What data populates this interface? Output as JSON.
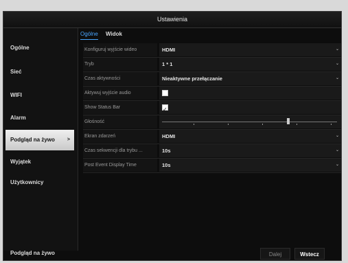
{
  "window": {
    "title": "Ustawienia"
  },
  "sidebar": {
    "items": [
      {
        "label": "Ogólne"
      },
      {
        "label": "Sieć"
      },
      {
        "label": "WIFI"
      },
      {
        "label": "Alarm"
      },
      {
        "label": "Podgląd na żywo",
        "active": true,
        "arrow": ">"
      },
      {
        "label": "Wyjątek"
      },
      {
        "label": "Użytkownicy"
      }
    ],
    "bottom_label": "Podgląd na żywo"
  },
  "tabs": [
    {
      "label": "Ogólne",
      "active": true
    },
    {
      "label": "Widok"
    }
  ],
  "settings": {
    "rows": [
      {
        "label": "Konfiguruj wyjście wideo",
        "value": "HDMI",
        "type": "dropdown"
      },
      {
        "label": "Tryb",
        "value": "1 * 1",
        "type": "dropdown"
      },
      {
        "label": "Czas aktywności",
        "value": "Nieaktywne przełączanie",
        "type": "dropdown"
      },
      {
        "label": "Aktywuj wyjście audio",
        "value": "",
        "type": "checkbox",
        "checked": false
      },
      {
        "label": "Show Status Bar",
        "value": "",
        "type": "checkbox",
        "checked": true
      },
      {
        "label": "Głośność",
        "value": "",
        "type": "slider",
        "level_fraction": 0.72
      },
      {
        "label": "Ekran zdarzeń",
        "value": "HDMI",
        "type": "dropdown"
      },
      {
        "label": "Czas sekwencji dla trybu ...",
        "value": "10s",
        "type": "dropdown"
      },
      {
        "label": "Post Event Display Time",
        "value": "10s",
        "type": "dropdown"
      }
    ],
    "caret": "⌄"
  },
  "buttons": {
    "next": "Dalej",
    "back": "Wstecz"
  },
  "colors": {
    "accent": "#49a5ff",
    "active_bg": "#e6e6e6",
    "window_bg": "#0d0d0d"
  }
}
